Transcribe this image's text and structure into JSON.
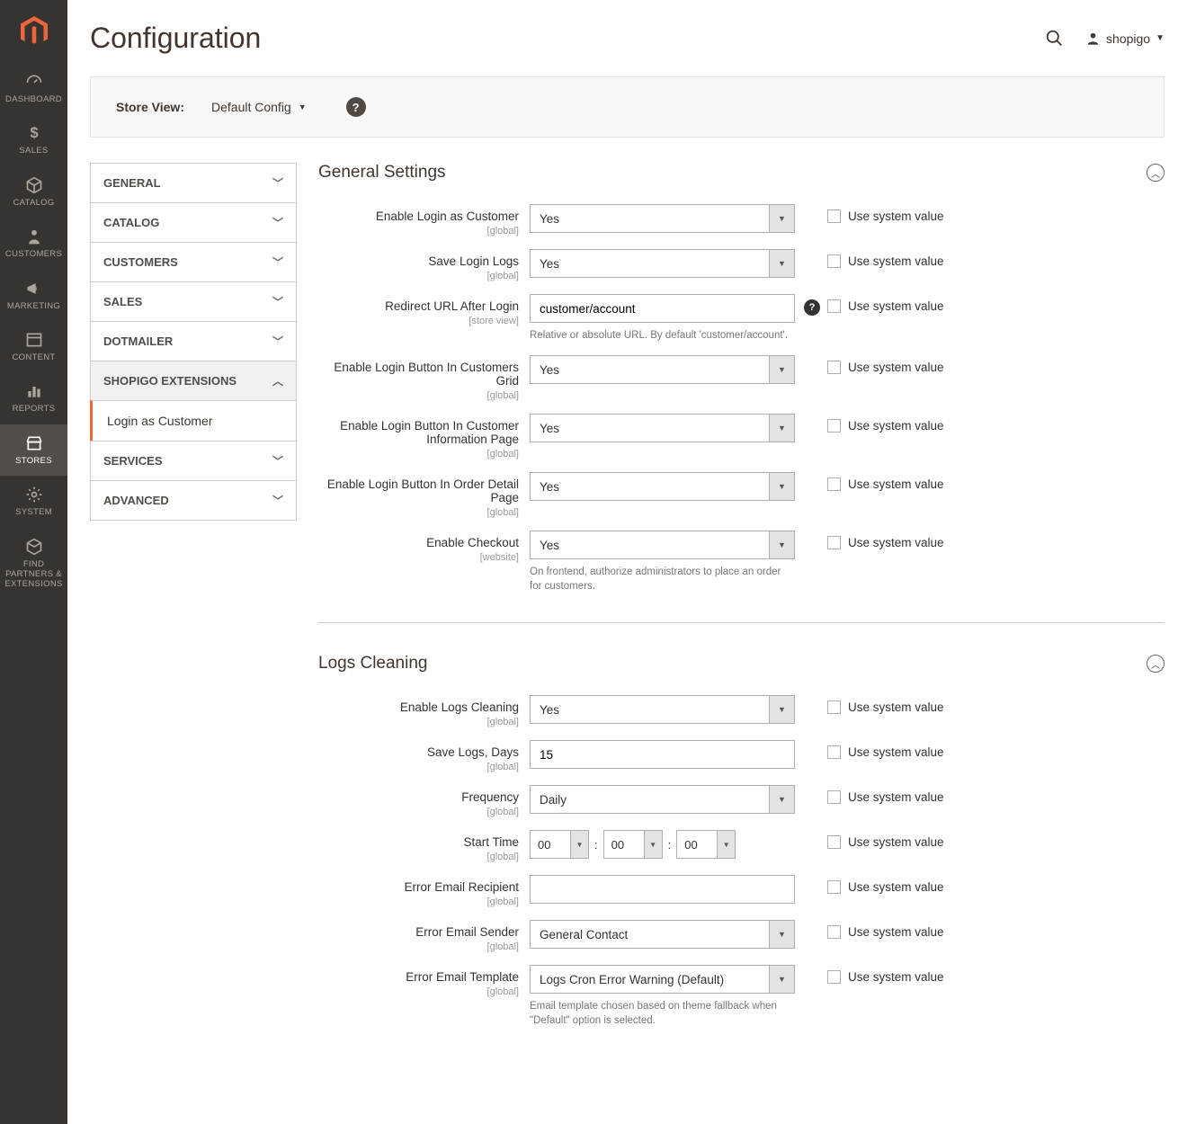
{
  "header": {
    "page_title": "Configuration",
    "user_name": "shopigo"
  },
  "store_view": {
    "label": "Store View:",
    "value": "Default Config"
  },
  "sidebar": {
    "items": [
      {
        "label": "DASHBOARD",
        "icon": "dashboard"
      },
      {
        "label": "SALES",
        "icon": "dollar"
      },
      {
        "label": "CATALOG",
        "icon": "box"
      },
      {
        "label": "CUSTOMERS",
        "icon": "person"
      },
      {
        "label": "MARKETING",
        "icon": "megaphone"
      },
      {
        "label": "CONTENT",
        "icon": "layout"
      },
      {
        "label": "REPORTS",
        "icon": "bars"
      },
      {
        "label": "STORES",
        "icon": "storefront",
        "active": true
      },
      {
        "label": "SYSTEM",
        "icon": "gear"
      },
      {
        "label": "FIND PARTNERS & EXTENSIONS",
        "icon": "puzzle"
      }
    ]
  },
  "tree": [
    {
      "label": "GENERAL",
      "expanded": false
    },
    {
      "label": "CATALOG",
      "expanded": false
    },
    {
      "label": "CUSTOMERS",
      "expanded": false
    },
    {
      "label": "SALES",
      "expanded": false
    },
    {
      "label": "DOTMAILER",
      "expanded": false
    },
    {
      "label": "SHOPIGO EXTENSIONS",
      "expanded": true,
      "child": "Login as Customer"
    },
    {
      "label": "SERVICES",
      "expanded": false
    },
    {
      "label": "ADVANCED",
      "expanded": false
    }
  ],
  "sections": {
    "general": {
      "title": "General Settings",
      "fields": [
        {
          "label": "Enable Login as Customer",
          "scope": "[global]",
          "type": "select",
          "value": "Yes",
          "use_system": true
        },
        {
          "label": "Save Login Logs",
          "scope": "[global]",
          "type": "select",
          "value": "Yes",
          "use_system": true
        },
        {
          "label": "Redirect URL After Login",
          "scope": "[store view]",
          "type": "text",
          "value": "customer/account",
          "use_system": true,
          "hint": "Relative or absolute URL. By default 'customer/account'.",
          "tooltip": true
        },
        {
          "label": "Enable Login Button In Customers Grid",
          "scope": "[global]",
          "type": "select",
          "value": "Yes",
          "use_system": true
        },
        {
          "label": "Enable Login Button In Customer Information Page",
          "scope": "[global]",
          "type": "select",
          "value": "Yes",
          "use_system": true
        },
        {
          "label": "Enable Login Button In Order Detail Page",
          "scope": "[global]",
          "type": "select",
          "value": "Yes",
          "use_system": true
        },
        {
          "label": "Enable Checkout",
          "scope": "[website]",
          "type": "select",
          "value": "Yes",
          "use_system": true,
          "hint": "On frontend, authorize administrators to place an order for customers."
        }
      ]
    },
    "logs": {
      "title": "Logs Cleaning",
      "fields": [
        {
          "label": "Enable Logs Cleaning",
          "scope": "[global]",
          "type": "select",
          "value": "Yes",
          "use_system": true
        },
        {
          "label": "Save Logs, Days",
          "scope": "[global]",
          "type": "text",
          "value": "15",
          "use_system": true
        },
        {
          "label": "Frequency",
          "scope": "[global]",
          "type": "select",
          "value": "Daily",
          "use_system": true
        },
        {
          "label": "Start Time",
          "scope": "[global]",
          "type": "time",
          "value": [
            "00",
            "00",
            "00"
          ],
          "use_system": true
        },
        {
          "label": "Error Email Recipient",
          "scope": "[global]",
          "type": "text",
          "value": "",
          "use_system": true
        },
        {
          "label": "Error Email Sender",
          "scope": "[global]",
          "type": "select",
          "value": "General Contact",
          "use_system": true
        },
        {
          "label": "Error Email Template",
          "scope": "[global]",
          "type": "select",
          "value": "Logs Cron Error Warning (Default)",
          "use_system": true,
          "hint": "Email template chosen based on theme fallback when \"Default\" option is selected."
        }
      ]
    }
  },
  "use_system_label": "Use system value"
}
